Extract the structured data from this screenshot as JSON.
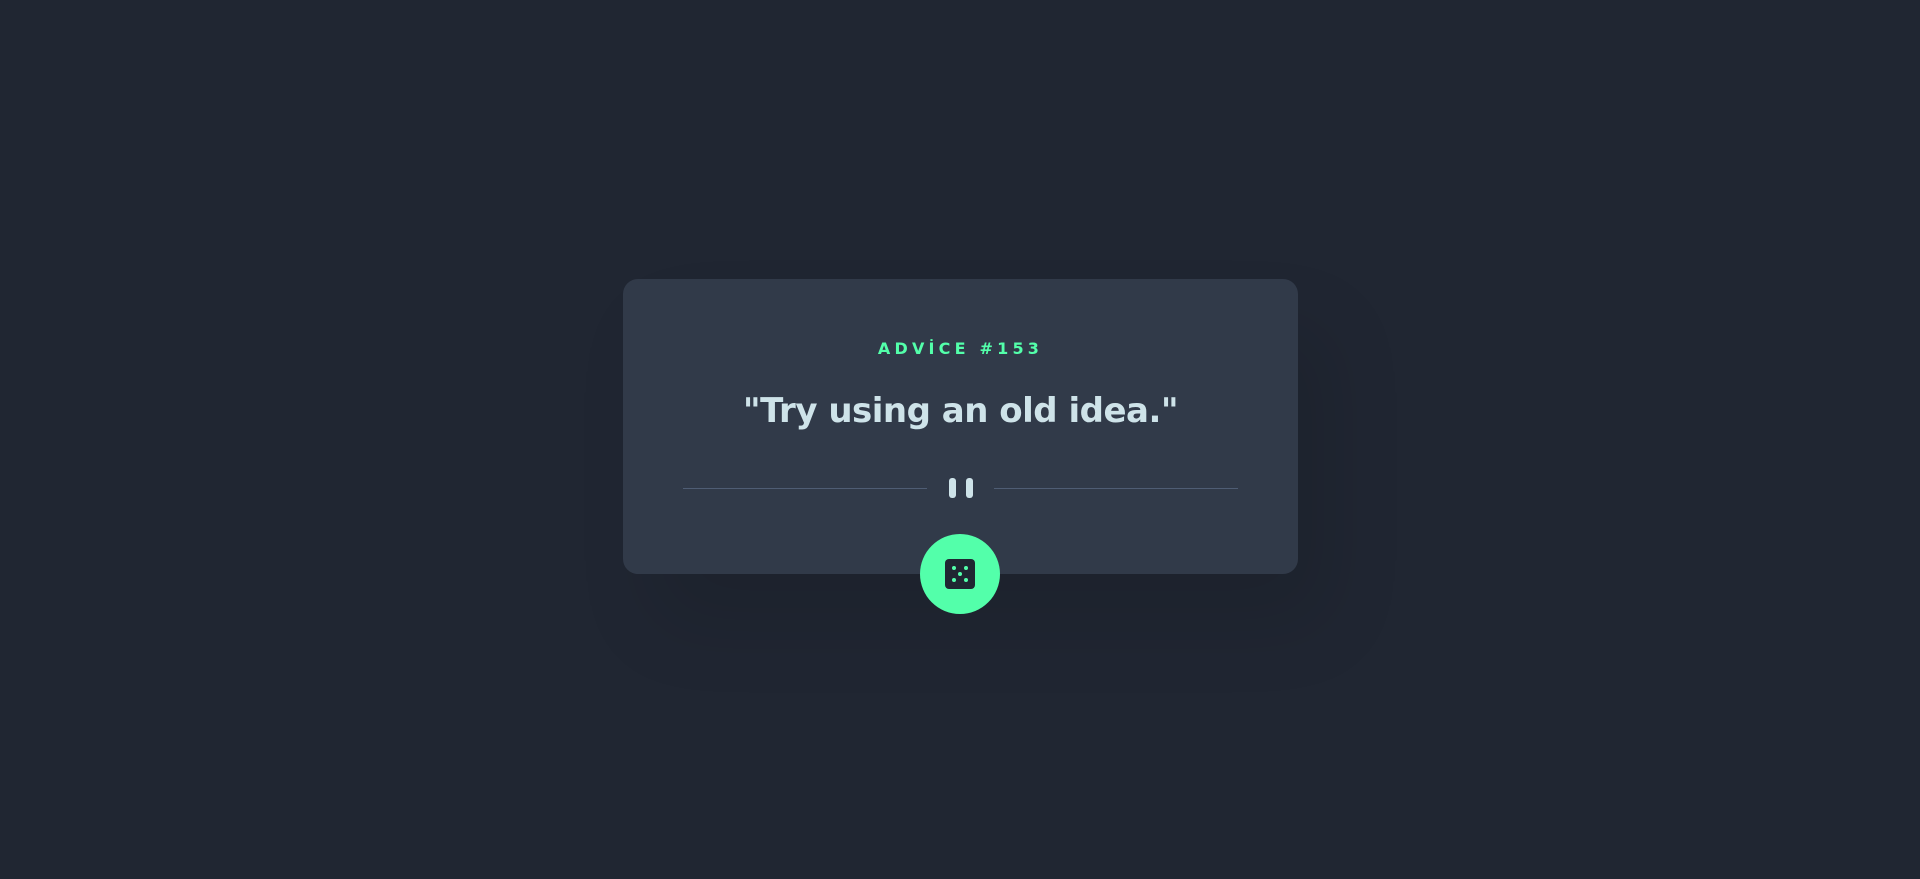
{
  "advice": {
    "id_label": "ADVİCE #153",
    "quote": "\"Try using an old idea.\""
  },
  "icons": {
    "divider": "pause-icon",
    "button": "dice-icon"
  },
  "colors": {
    "background": "#202632",
    "card": "#313A49",
    "accent": "#53FFAA",
    "text": "#CEE3E9",
    "divider": "#4F5D74"
  }
}
